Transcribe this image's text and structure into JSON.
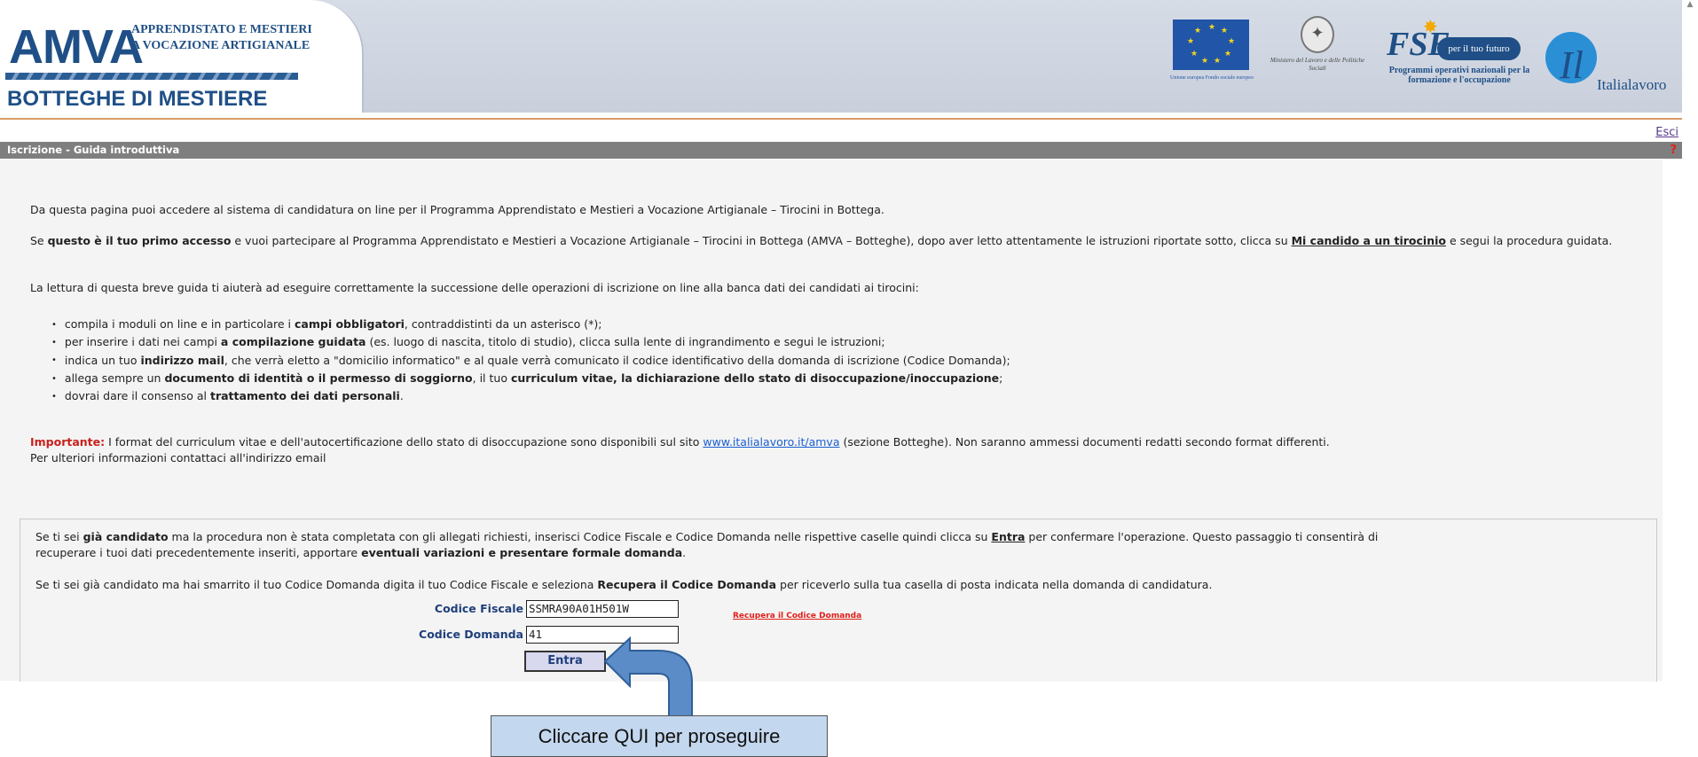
{
  "header": {
    "logo_amva": "AMVA",
    "logo_sub_1": "APPRENDISTATO E MESTIERI",
    "logo_sub_2": "A VOCAZIONE ARTIGIANALE",
    "logo_botteghe": "BOTTEGHE DI MESTIERE",
    "eu_text": "Unione europea Fondo sociale europeo",
    "ministry_text": "Ministero del Lavoro e delle Politiche Sociali",
    "fse_pill": "per il tuo futuro",
    "fse_text": "Programmi operativi nazionali per la formazione e l'occupazione",
    "italialavoro": "Italialavoro"
  },
  "exit_label": "Esci",
  "section_title": "Iscrizione - Guida introduttiva",
  "help_label": "?",
  "intro": {
    "p1": "Da questa pagina puoi accedere al sistema di candidatura on line per il Programma Apprendistato e Mestieri a Vocazione Artigianale – Tirocini in Bottega.",
    "p2_a": "Se ",
    "p2_b": "questo è il tuo primo accesso",
    "p2_c": " e vuoi partecipare al Programma Apprendistato e Mestieri a Vocazione Artigianale – Tirocini in Bottega (AMVA – Botteghe), dopo aver letto attentamente le istruzioni riportate sotto, clicca su ",
    "p2_link": "Mi candido a un tirocinio",
    "p2_d": " e segui la procedura guidata.",
    "p3": "La lettura di questa breve guida ti aiuterà ad eseguire correttamente la successione delle operazioni di iscrizione on line alla banca dati dei candidati ai tirocini:"
  },
  "rules": [
    {
      "a": "compila i moduli on line e in particolare i ",
      "b": "campi obbligatori",
      "c": ", contraddistinti da un asterisco (*);"
    },
    {
      "a": "per inserire i dati nei campi ",
      "b": "a compilazione guidata",
      "c": " (es. luogo di nascita, titolo di studio), clicca sulla lente di ingrandimento e segui le istruzioni;"
    },
    {
      "a": "indica un  tuo ",
      "b": "indirizzo mail",
      "c": ", che verrà eletto a \"domicilio informatico\" e al quale verrà comunicato il codice identificativo della domanda di iscrizione (Codice Domanda);"
    },
    {
      "a": "allega sempre un ",
      "b": "documento di identità o il permesso di soggiorno",
      "c": ", il tuo ",
      "d": "curriculum vitae, la dichiarazione dello stato di disoccupazione/inoccupazione",
      "e": ";"
    },
    {
      "a": "dovrai dare il consenso al ",
      "b": "trattamento dei dati personali",
      "c": "."
    }
  ],
  "important": {
    "label": "Importante:",
    "text_a": " I format del curriculum vitae e dell'autocertificazione dello stato di disoccupazione sono disponibili sul sito ",
    "link": "www.italialavoro.it/amva",
    "text_b": " (sezione Botteghe). Non saranno ammessi documenti redatti secondo format differenti.",
    "line2": "Per ulteriori informazioni contattaci all'indirizzo email"
  },
  "box": {
    "p1_a": "Se ti sei ",
    "p1_b": "già candidato",
    "p1_c": " ma la procedura non è stata completata con gli allegati richiesti, inserisci Codice Fiscale e Codice Domanda nelle rispettive caselle quindi clicca su ",
    "p1_link": "Entra",
    "p1_d": " per confermare l'operazione. Questo passaggio ti consentirà di",
    "p1_e": "recuperare i tuoi dati precedentemente inseriti, apportare ",
    "p1_f": "eventuali variazioni e presentare formale domanda",
    "p1_g": ".",
    "p2_a": "Se ti sei già candidato ma hai smarrito il tuo Codice Domanda digita il tuo Codice Fiscale e seleziona ",
    "p2_b": "Recupera il Codice Domanda",
    "p2_c": " per riceverlo sulla tua casella di posta indicata nella domanda di candidatura."
  },
  "form": {
    "codice_fiscale_label": "Codice Fiscale",
    "codice_fiscale_value": "SSMRA90A01H501W",
    "codice_domanda_label": "Codice Domanda",
    "codice_domanda_value": "41",
    "recupera_label": "Recupera il Codice Domanda",
    "entra_label": "Entra"
  },
  "callout": "Cliccare QUI per proseguire",
  "colors": {
    "accent": "#1f4f86",
    "arrow": "#5b8cc7",
    "callout_bg": "#c3d7ee",
    "error": "#e0201a"
  }
}
